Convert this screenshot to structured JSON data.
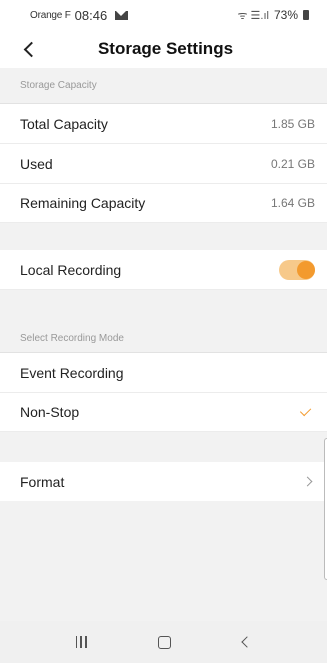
{
  "status_bar": {
    "carrier": "Orange F",
    "time": "08:46",
    "signal_glyphs": "ᯤ ☰.ıl",
    "battery": "73%"
  },
  "header": {
    "title": "Storage Settings",
    "back_icon": "chevron-left-icon"
  },
  "storage": {
    "section_label": "Storage Capacity",
    "rows": [
      {
        "label": "Total Capacity",
        "value": "1.85 GB"
      },
      {
        "label": "Used",
        "value": "0.21 GB"
      },
      {
        "label": "Remaining Capacity",
        "value": "1.64 GB"
      }
    ]
  },
  "local_recording": {
    "label": "Local Recording",
    "enabled": true,
    "accent_color": "#f39a2e"
  },
  "recording_mode": {
    "section_label": "Select Recording Mode",
    "options": [
      {
        "label": "Event Recording",
        "selected": false
      },
      {
        "label": "Non-Stop",
        "selected": true
      }
    ]
  },
  "format": {
    "label": "Format"
  },
  "nav_bar": {
    "icons": [
      "recents-icon",
      "home-icon",
      "back-icon"
    ]
  }
}
